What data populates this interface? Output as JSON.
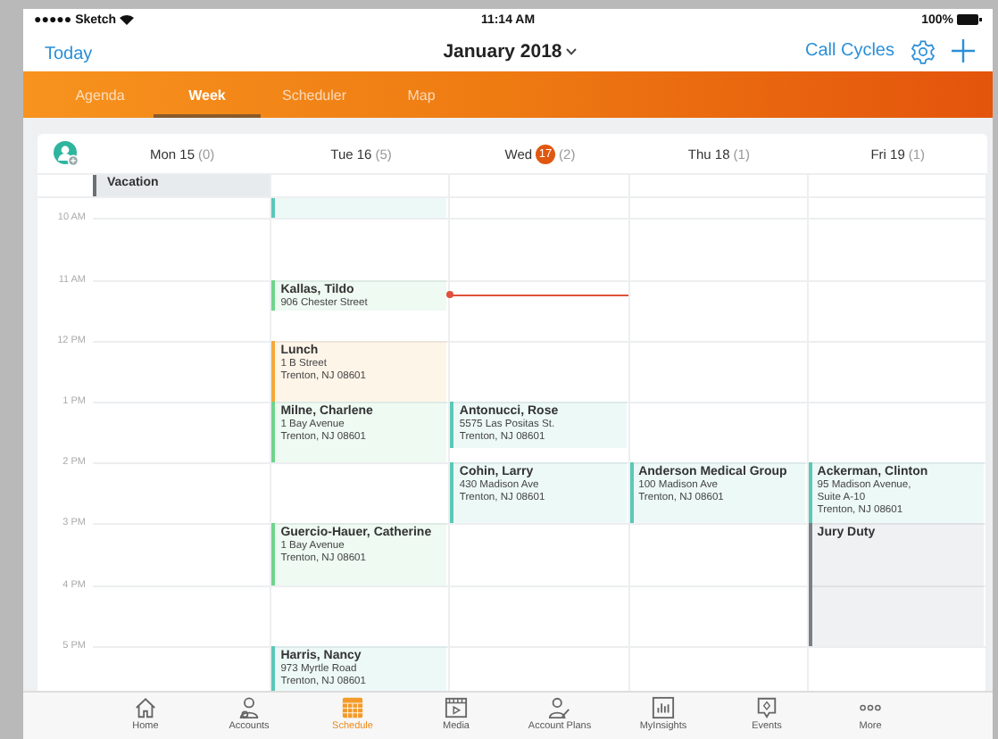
{
  "status_bar": {
    "carrier": "●●●●● Sketch",
    "time": "11:14 AM",
    "battery": "100%"
  },
  "nav": {
    "today": "Today",
    "title": "January 2018",
    "call_cycles": "Call Cycles"
  },
  "view_tabs": [
    {
      "label": "Agenda",
      "selected": false
    },
    {
      "label": "Week",
      "selected": true
    },
    {
      "label": "Scheduler",
      "selected": false
    },
    {
      "label": "Map",
      "selected": false
    }
  ],
  "calendar": {
    "hours": [
      "10 AM",
      "11 AM",
      "12 PM",
      "1 PM",
      "2 PM",
      "3 PM",
      "4 PM",
      "5 PM"
    ],
    "days": [
      {
        "name": "Mon",
        "date": "15",
        "count": "(0)",
        "today": false,
        "all_day": "Vacation"
      },
      {
        "name": "Tue",
        "date": "16",
        "count": "(5)",
        "today": false,
        "events": [
          {
            "color": "#5cc8b6"
          },
          {
            "title": "Kallas, Tildo",
            "lines": [
              "906 Chester Street"
            ],
            "color": "#6fd48c"
          },
          {
            "title": "Lunch",
            "lines": [
              "1 B Street",
              "Trenton, NJ 08601"
            ],
            "color": "#f5a83a"
          },
          {
            "title": "Milne, Charlene",
            "lines": [
              "1 Bay Avenue",
              "Trenton, NJ 08601"
            ],
            "color": "#6fd48c"
          },
          {
            "title": "Guercio-Hauer, Catherine",
            "lines": [
              "1 Bay Avenue",
              "Trenton, NJ 08601"
            ],
            "color": "#6fd48c"
          },
          {
            "title": "Harris, Nancy",
            "lines": [
              "973 Myrtle Road",
              "Trenton, NJ 08601"
            ],
            "color": "#5cc8b6"
          }
        ]
      },
      {
        "name": "Wed",
        "date": "17",
        "count": "(2)",
        "today": true,
        "events": [
          {
            "title": "Antonucci, Rose",
            "lines": [
              "5575 Las Positas St.",
              "Trenton, NJ 08601"
            ],
            "color": "#5cc8b6"
          },
          {
            "title": "Cohin, Larry",
            "lines": [
              "430 Madison Ave",
              "Trenton, NJ 08601"
            ],
            "color": "#5cc8b6"
          }
        ]
      },
      {
        "name": "Thu",
        "date": "18",
        "count": "(1)",
        "today": false,
        "events": [
          {
            "title": "Anderson Medical Group",
            "lines": [
              "100 Madison Ave",
              "Trenton, NJ 08601"
            ],
            "color": "#5cc8b6"
          }
        ]
      },
      {
        "name": "Fri",
        "date": "19",
        "count": "(1)",
        "today": false,
        "events": [
          {
            "title": "Ackerman, Clinton",
            "lines": [
              "95 Madison Avenue,",
              "Suite A-10",
              "Trenton, NJ 08601"
            ],
            "color": "#5cc8b6"
          },
          {
            "title": "Jury Duty",
            "color": "#7a7f85"
          }
        ]
      }
    ]
  },
  "bottom_tabs": [
    {
      "label": "Home",
      "selected": false
    },
    {
      "label": "Accounts",
      "selected": false
    },
    {
      "label": "Schedule",
      "selected": true
    },
    {
      "label": "Media",
      "selected": false
    },
    {
      "label": "Account Plans",
      "selected": false
    },
    {
      "label": "MyInsights",
      "selected": false
    },
    {
      "label": "Events",
      "selected": false
    },
    {
      "label": "More",
      "selected": false
    }
  ]
}
